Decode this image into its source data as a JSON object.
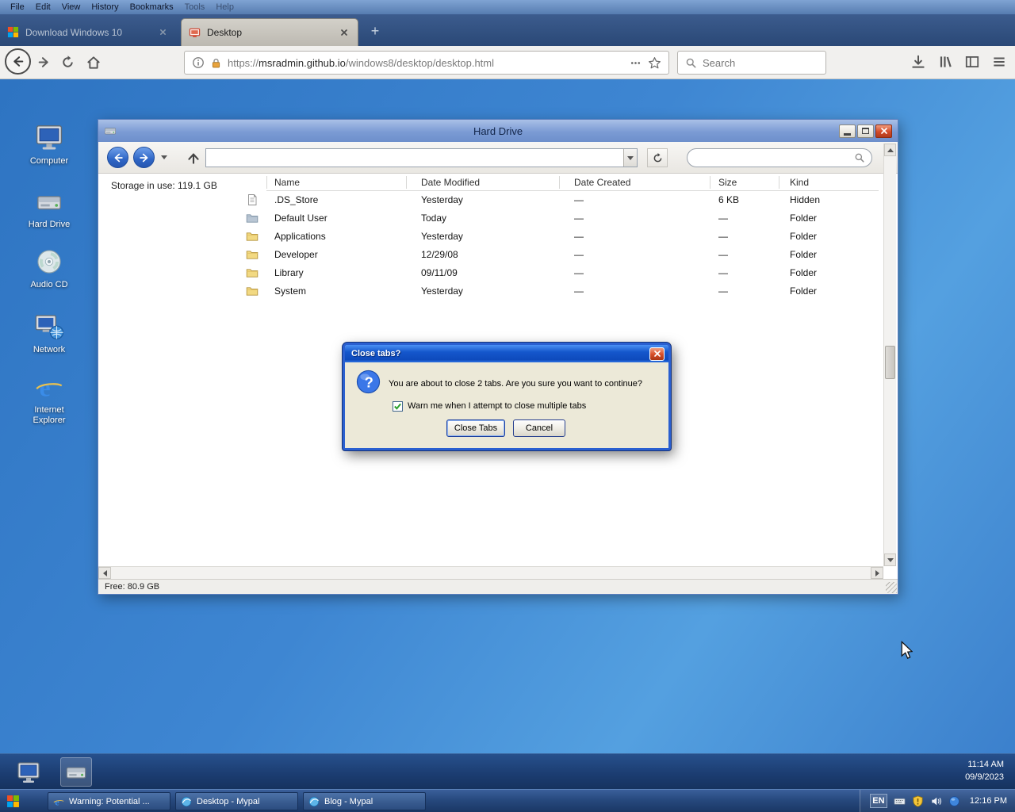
{
  "glyphs": {
    "plus": "+",
    "question": "?",
    "ie_e": "e"
  },
  "browser": {
    "menubar": [
      {
        "label": "File"
      },
      {
        "label": "Edit"
      },
      {
        "label": "View"
      },
      {
        "label": "History"
      },
      {
        "label": "Bookmarks"
      },
      {
        "label": "Tools"
      },
      {
        "label": "Help"
      }
    ],
    "tabs": [
      {
        "label": "Download Windows 10",
        "active": false
      },
      {
        "label": "Desktop",
        "active": true
      }
    ],
    "urlbar": {
      "scheme": "https://",
      "host": "msradmin.github.io",
      "path": "/windows8/desktop/desktop.html"
    },
    "search_placeholder": "Search"
  },
  "desktop": {
    "icons": [
      {
        "label": "Computer"
      },
      {
        "label": "Hard Drive"
      },
      {
        "label": "Audio CD"
      },
      {
        "label": "Network"
      },
      {
        "label": "Internet Explorer"
      }
    ],
    "taskbar_clock": {
      "time": "11:14 AM",
      "date": "09/9/2023"
    }
  },
  "finder": {
    "title": "Hard Drive",
    "storage_in_use": "Storage in use: 119.1 GB",
    "free_space": "Free: 80.9 GB",
    "columns": [
      {
        "label": "Name"
      },
      {
        "label": "Date Modified"
      },
      {
        "label": "Date Created"
      },
      {
        "label": "Size"
      },
      {
        "label": "Kind"
      }
    ],
    "rows": [
      {
        "name": ".DS_Store",
        "modified": "Yesterday",
        "created": "—",
        "size": "6 KB",
        "kind": "Hidden"
      },
      {
        "name": "Default User",
        "modified": "Today",
        "created": "—",
        "size": "—",
        "kind": "Folder"
      },
      {
        "name": "Applications",
        "modified": "Yesterday",
        "created": "—",
        "size": "—",
        "kind": "Folder"
      },
      {
        "name": "Developer",
        "modified": "12/29/08",
        "created": "—",
        "size": "—",
        "kind": "Folder"
      },
      {
        "name": "Library",
        "modified": "09/11/09",
        "created": "—",
        "size": "—",
        "kind": "Folder"
      },
      {
        "name": "System",
        "modified": "Yesterday",
        "created": "—",
        "size": "—",
        "kind": "Folder"
      }
    ]
  },
  "dialog": {
    "title": "Close tabs?",
    "message": "You are about to close 2 tabs. Are you sure you want to continue?",
    "checkbox_label": "Warn me when I attempt to close multiple tabs",
    "checkbox_checked": true,
    "confirm_label": "Close Tabs",
    "cancel_label": "Cancel"
  },
  "taskbar": {
    "buttons": [
      {
        "label": "Warning: Potential ..."
      },
      {
        "label": "Desktop - Mypal"
      },
      {
        "label": "Blog - Mypal"
      }
    ],
    "tray": {
      "language": "EN",
      "time": "12:16 PM"
    }
  }
}
